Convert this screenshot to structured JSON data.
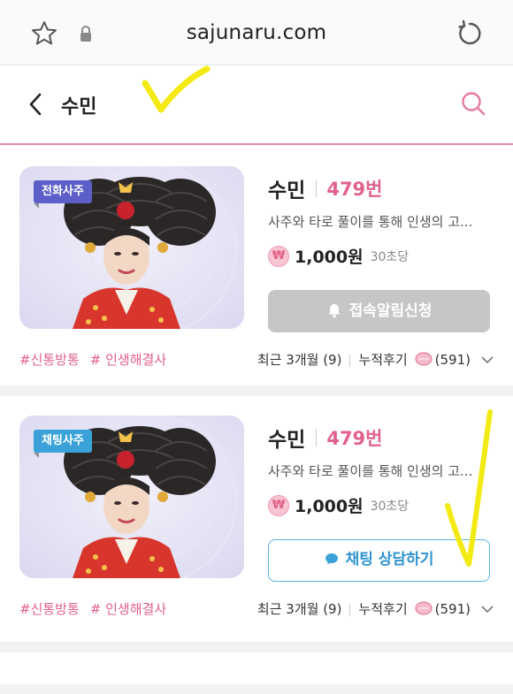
{
  "browser": {
    "url": "sajunaru.com",
    "icons": [
      "star-icon",
      "lock-icon",
      "reload-icon"
    ]
  },
  "header": {
    "title": "수민",
    "icons": [
      "back-icon",
      "search-icon"
    ]
  },
  "accent_color": "#e1628a",
  "cards": [
    {
      "badge": "전화사주",
      "badge_color": "#5b5fc7",
      "name": "수민",
      "number": "479번",
      "description": "사주와 타로 풀이를 통해 인생의 고...",
      "coin_symbol": "₩",
      "price": "1,000원",
      "unit": "30초당",
      "button_label": "접속알림신청",
      "button_icon": "bell-icon",
      "tags": [
        "#신통방통",
        "# 인생해결사"
      ],
      "recent": "최근 3개월 (9)",
      "cumulative_label": "누적후기",
      "review_count": "(591)"
    },
    {
      "badge": "채팅사주",
      "badge_color": "#3aa2d8",
      "name": "수민",
      "number": "479번",
      "description": "사주와 타로 풀이를 통해 인생의 고...",
      "coin_symbol": "₩",
      "price": "1,000원",
      "unit": "30초당",
      "button_label": "채팅 상담하기",
      "button_icon": "chat-bubble-icon",
      "tags": [
        "#신통방통",
        "# 인생해결사"
      ],
      "recent": "최근 3개월 (9)",
      "cumulative_label": "누적후기",
      "review_count": "(591)"
    }
  ]
}
